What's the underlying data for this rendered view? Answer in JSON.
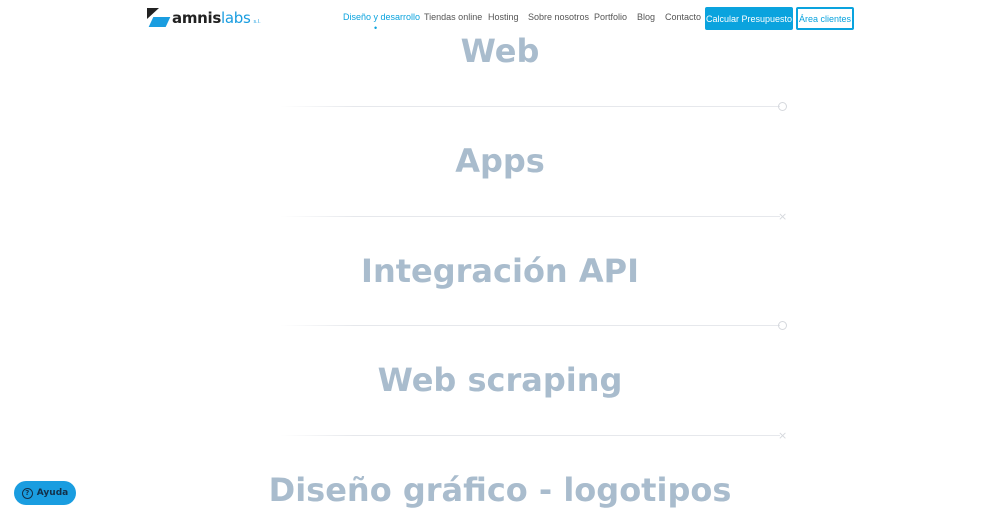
{
  "logo": {
    "name": "amnis",
    "name2": "labs",
    "suffix": "s.l."
  },
  "nav": {
    "items": [
      "Diseño y desarrollo",
      "Tiendas online",
      "Hosting",
      "Sobre nosotros",
      "Portfolio",
      "Blog",
      "Contacto"
    ],
    "active_icon": "droplet-icon"
  },
  "buttons": {
    "quote": "Calcular Presupuesto",
    "clients": "Área clientes"
  },
  "sections": [
    "Web",
    "Apps",
    "Integración API",
    "Web scraping",
    "Diseño gráfico - logotipos"
  ],
  "help": {
    "label": "Ayuda",
    "icon": "question-icon"
  },
  "colors": {
    "accent": "#0aa3de",
    "heading": "#a9bccd"
  }
}
